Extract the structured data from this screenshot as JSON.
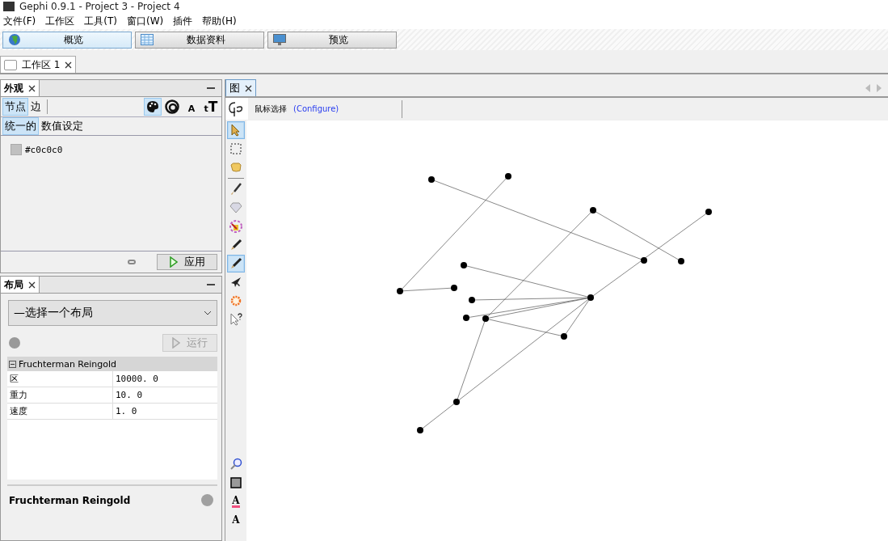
{
  "window": {
    "title": "Gephi 0.9.1 - Project 3 - Project 4"
  },
  "menu": [
    "文件(F)",
    "工作区",
    "工具(T)",
    "窗口(W)",
    "插件",
    "帮助(H)"
  ],
  "perspectives": [
    {
      "kind": "globe",
      "label": "概览",
      "selected": true
    },
    {
      "kind": "table",
      "label": "数据资料",
      "selected": false
    },
    {
      "kind": "monitor",
      "label": "预览",
      "selected": false
    }
  ],
  "workspace_tab": {
    "label": "工作区",
    "number": "1"
  },
  "appearance": {
    "title": "外观",
    "element_tabs": [
      {
        "label": "节点",
        "selected": true
      },
      {
        "label": "边",
        "selected": false
      }
    ],
    "property_buttons": [
      {
        "kind": "palette",
        "selected": true
      },
      {
        "kind": "size",
        "selected": false
      },
      {
        "kind": "label-color",
        "text": "A",
        "selected": false
      },
      {
        "kind": "label-size",
        "text": "tT",
        "selected": false
      }
    ],
    "mode_tabs": [
      {
        "label": "统一的",
        "selected": true
      },
      {
        "label": "数值设定",
        "selected": false
      }
    ],
    "color": {
      "value": "#c0c0c0",
      "color": "#c0c0c0"
    },
    "apply_button": "应用"
  },
  "layout": {
    "title": "布局",
    "dropdown": "—选择一个布局",
    "run_button": {
      "label": "运行",
      "disabled": true
    },
    "section": "Fruchterman Reingold",
    "properties": [
      {
        "name": "区",
        "value": "10000. 0"
      },
      {
        "name": "重力",
        "value": "10. 0"
      },
      {
        "name": "速度",
        "value": "1. 0"
      }
    ],
    "description_title": "Fruchterman Reingold"
  },
  "graph": {
    "tab": "图",
    "tool_label": "鼠标选择",
    "configure_link": "(Configure)",
    "tools": [
      {
        "kind": "pointer",
        "selected": true
      },
      {
        "kind": "rect-select",
        "selected": false
      },
      {
        "kind": "lasso",
        "selected": false
      },
      {
        "kind": "separator"
      },
      {
        "kind": "brush",
        "selected": false
      },
      {
        "kind": "diamond",
        "selected": false
      },
      {
        "kind": "painter",
        "selected": false
      },
      {
        "kind": "pencil",
        "selected": false
      },
      {
        "kind": "pencil",
        "selected": true
      },
      {
        "kind": "plane",
        "selected": false
      },
      {
        "kind": "sun",
        "selected": false
      },
      {
        "kind": "help-pointer",
        "selected": false
      }
    ],
    "bottom_tools": [
      {
        "kind": "zoom"
      },
      {
        "kind": "square"
      },
      {
        "kind": "label-color",
        "text": "A"
      },
      {
        "kind": "label-size",
        "text": "A"
      }
    ]
  }
}
